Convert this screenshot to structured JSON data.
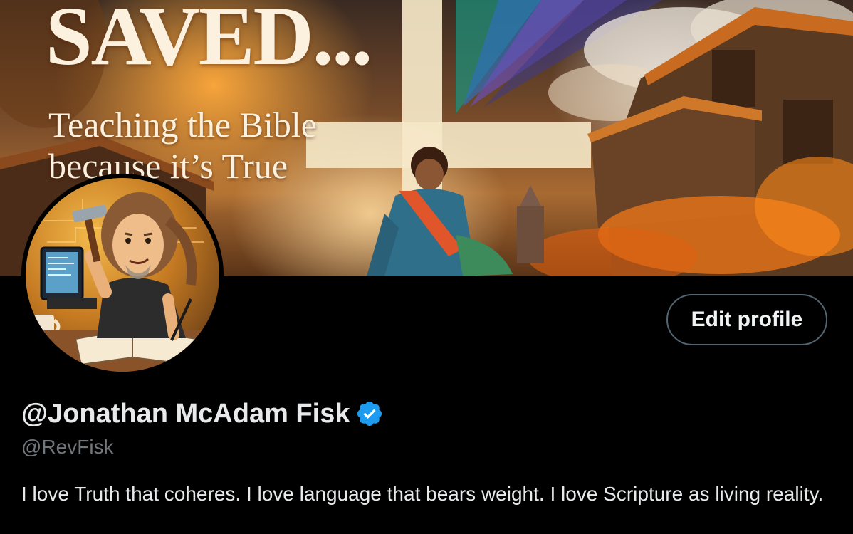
{
  "banner": {
    "title": "SAVED...",
    "subtitle_line1": "Teaching the Bible",
    "subtitle_line2": "because it’s True"
  },
  "avatar": {
    "icon": "avatar-illustration-icon"
  },
  "actions": {
    "edit_profile_label": "Edit profile"
  },
  "profile": {
    "display_name": "@Jonathan McAdam Fisk",
    "verified_icon": "verified-badge-icon",
    "verified_color": "#1d9bf0",
    "handle": "@RevFisk",
    "bio": "I love Truth that coheres. I love language that bears weight. I love Scripture as living reality."
  },
  "colors": {
    "background": "#000000",
    "text_primary": "#e7e9ea",
    "text_secondary": "#71767b",
    "button_border": "#536471"
  }
}
